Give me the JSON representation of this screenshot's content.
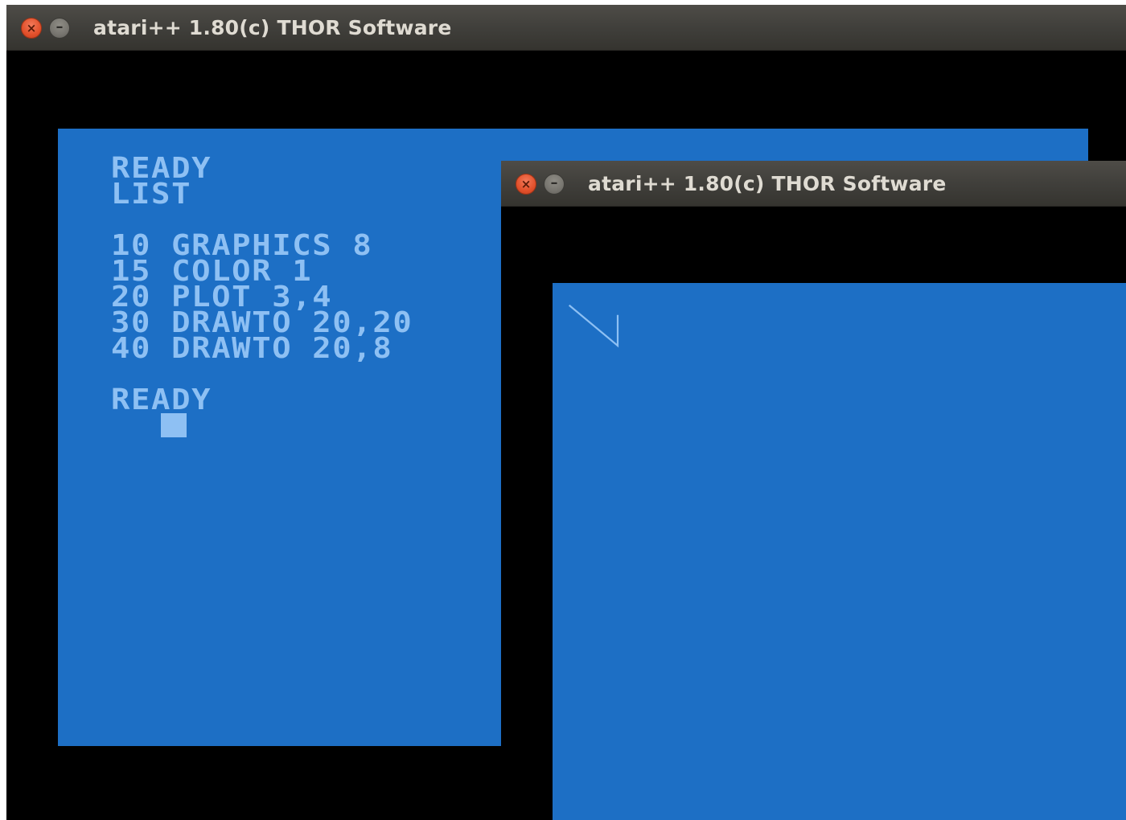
{
  "colors": {
    "screen_background": "#1d6fc5",
    "screen_foreground": "#8ec0f3",
    "border": "#000000",
    "titlebar": "#3f3e3a",
    "title_text": "#dfdbd2",
    "close_button": "#e2502b"
  },
  "windows": {
    "back": {
      "title": "atari++ 1.80(c) THOR Software",
      "close_glyph": "×",
      "minimize_glyph": "–",
      "screen_lines": [
        "READY",
        "LIST",
        "",
        "10 GRAPHICS 8",
        "15 COLOR 1",
        "20 PLOT 3,4",
        "30 DRAWTO 20,20",
        "40 DRAWTO 20,8",
        "",
        "READY"
      ]
    },
    "front": {
      "title": "atari++ 1.80(c) THOR Software",
      "close_glyph": "×",
      "minimize_glyph": "–",
      "graphics_mode": 8,
      "plot_color": 1,
      "plot_path": [
        [
          3,
          4
        ],
        [
          20,
          20
        ],
        [
          20,
          8
        ]
      ]
    }
  }
}
